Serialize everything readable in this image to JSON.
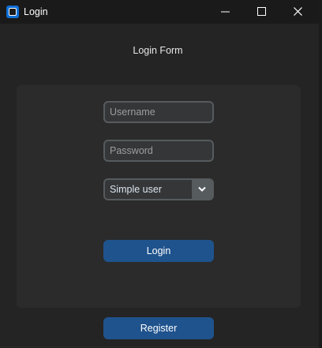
{
  "window": {
    "title": "Login",
    "icon": "app-window-icon",
    "controls": [
      "minimize-icon",
      "maximize-icon",
      "close-icon"
    ]
  },
  "form": {
    "title": "Login Form",
    "username": {
      "value": "",
      "placeholder": "Username"
    },
    "password": {
      "value": "",
      "placeholder": "Password"
    },
    "role": {
      "selected": "Simple user",
      "icon": "chevron-down-icon"
    },
    "login_label": "Login",
    "register_label": "Register"
  },
  "colors": {
    "background": "#242424",
    "panel": "#2b2b2b",
    "entry_bg": "#343638",
    "entry_border": "#565b5e",
    "button": "#1f538d",
    "text": "#dce4ee"
  }
}
